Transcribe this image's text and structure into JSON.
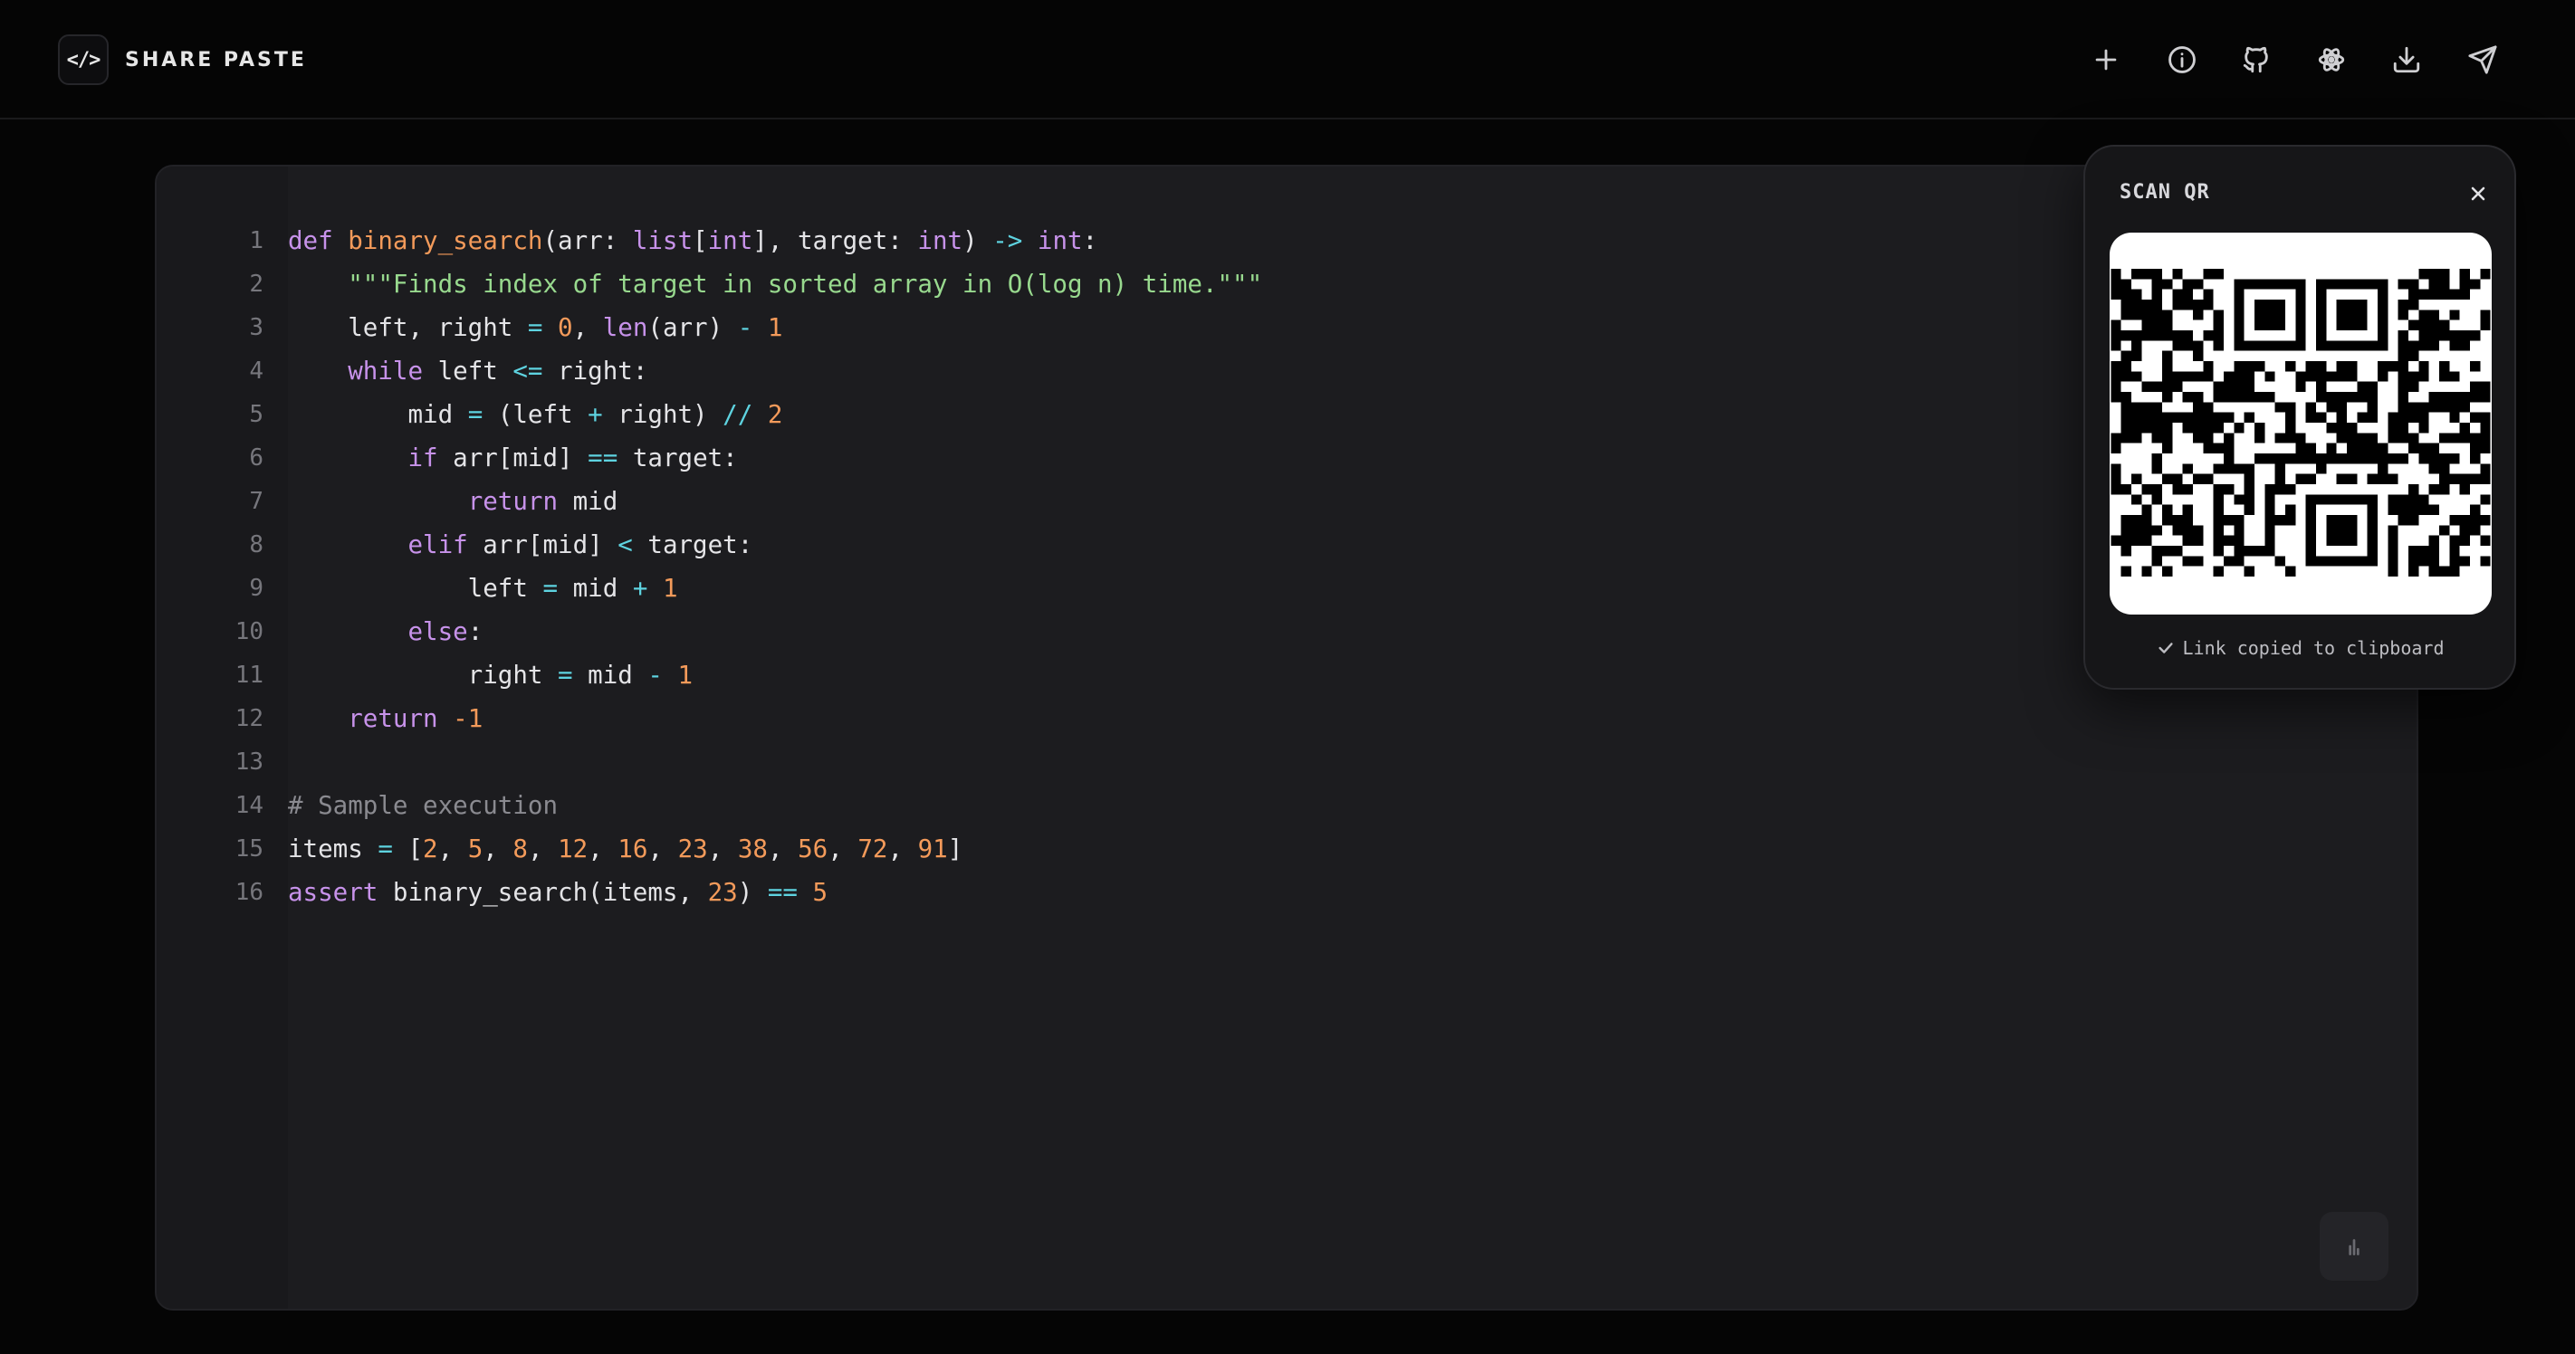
{
  "header": {
    "logo_glyph": "</>",
    "app_name": "SHARE PASTE",
    "icons": [
      "plus-icon",
      "info-icon",
      "github-icon",
      "react-icon",
      "download-icon",
      "send-icon"
    ]
  },
  "editor": {
    "line_numbers": [
      "1",
      "2",
      "3",
      "4",
      "5",
      "6",
      "7",
      "8",
      "9",
      "10",
      "11",
      "12",
      "13",
      "14",
      "15",
      "16"
    ],
    "lines": [
      "def binary_search(arr: list[int], target: int) -> int:",
      "    \"\"\"Finds index of target in sorted array in O(log n) time.\"\"\"",
      "    left, right = 0, len(arr) - 1",
      "    while left <= right:",
      "        mid = (left + right) // 2",
      "        if arr[mid] == target:",
      "            return mid",
      "        elif arr[mid] < target:",
      "            left = mid + 1",
      "        else:",
      "            right = mid - 1",
      "    return -1",
      "",
      "# Sample execution",
      "items = [2, 5, 8, 12, 16, 23, 38, 56, 72, 91]",
      "assert binary_search(items, 23) == 5"
    ],
    "language": "python",
    "colors": {
      "keyword": "#c792ea",
      "function": "#f39a5a",
      "string": "#98d98e",
      "number": "#f39a5a",
      "operator": "#5ed3e0",
      "comment": "#8a8a90",
      "text": "#e4e4e7"
    }
  },
  "qr_popup": {
    "title": "SCAN QR",
    "status": "Link copied to clipboard"
  },
  "colors": {
    "background": "#050505",
    "editor_bg": "#1c1c1f",
    "popup_bg": "#161618"
  }
}
